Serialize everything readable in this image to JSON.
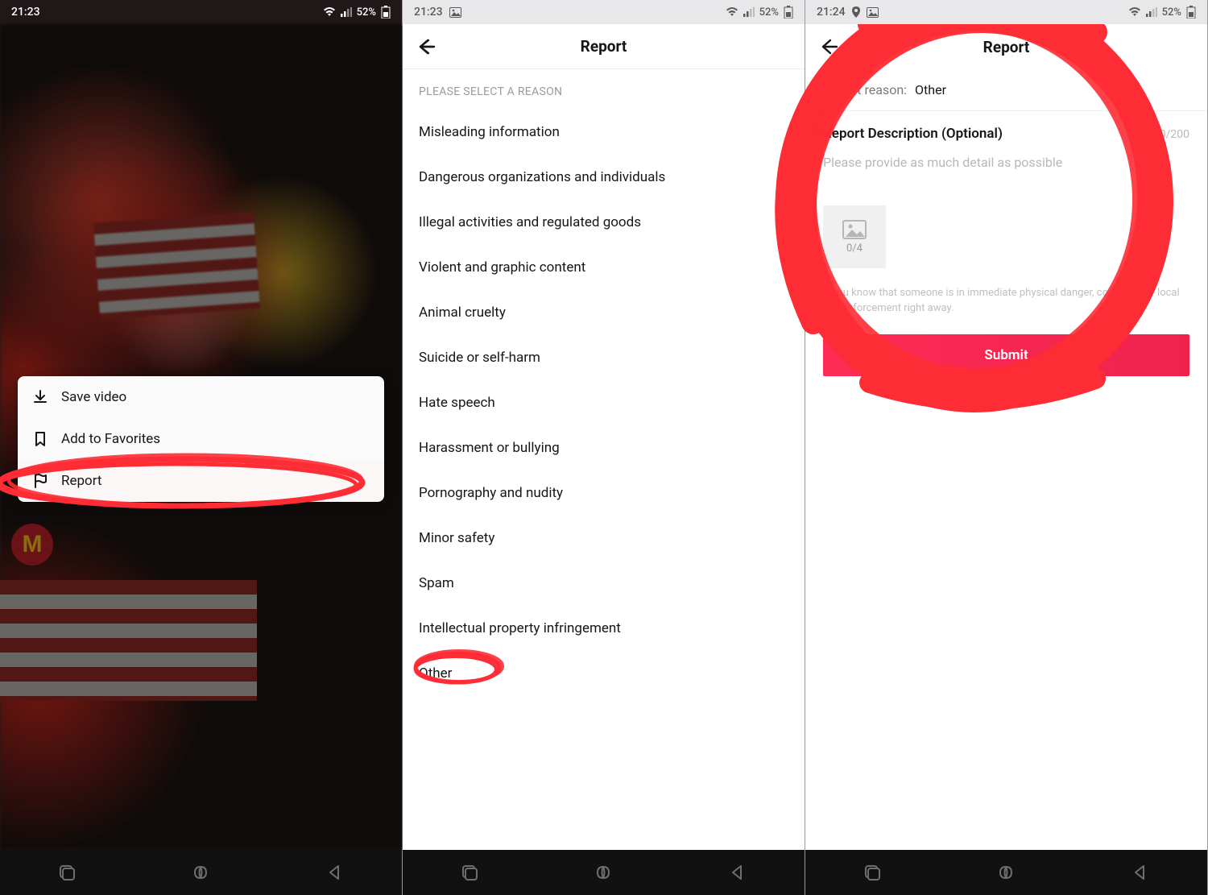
{
  "status": {
    "panel1_time": "21:23",
    "panel2_time": "21:23",
    "panel3_time": "21:24",
    "battery_pct": "52%"
  },
  "panel1": {
    "menu": {
      "save": "Save video",
      "favorites": "Add to Favorites",
      "report": "Report"
    }
  },
  "panel2": {
    "title": "Report",
    "section_label": "PLEASE SELECT A REASON",
    "reasons": [
      "Misleading information",
      "Dangerous organizations and individuals",
      "Illegal activities and regulated goods",
      "Violent and graphic content",
      "Animal cruelty",
      "Suicide or self-harm",
      "Hate speech",
      "Harassment or bullying",
      "Pornography and nudity",
      "Minor safety",
      "Spam",
      "Intellectual property infringement",
      "Other"
    ]
  },
  "panel3": {
    "title": "Report",
    "reason_label": "Report reason:",
    "reason_value": "Other",
    "desc_title": "Report Description (Optional)",
    "counter": "0/200",
    "placeholder": "Please provide as much detail as possible",
    "upload_count": "0/4",
    "notice": "If you know that someone is in immediate physical danger, contact your local law enforcement right away.",
    "submit": "Submit"
  }
}
